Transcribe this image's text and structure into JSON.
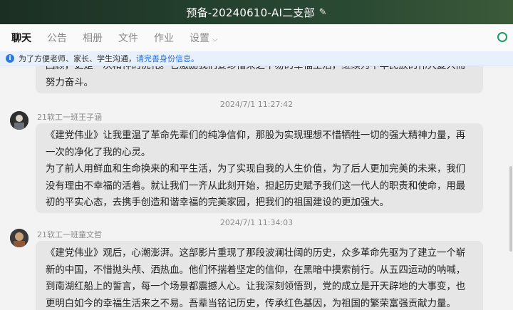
{
  "window": {
    "title": "预备-20240610-AI二支部"
  },
  "tabs": [
    "聊天",
    "公告",
    "相册",
    "文件",
    "作业",
    "设置"
  ],
  "notice": {
    "text": "为了方便老师、家长、学生沟通，",
    "link": "请完善身份信息。"
  },
  "messages": [
    {
      "time": "",
      "sender": "",
      "lines": [
        "回顾，更是一次精神的洗礼。它激励我们要珍惜来之不易的幸福生活，继续为中华民族的伟大复兴而",
        "努力奋斗。"
      ]
    },
    {
      "time": "2024/7/1 11:27:42",
      "sender": "21软工一班王子涵",
      "lines": [
        "《建党伟业》让我重温了革命先辈们的纯净信仰，那股为实现理想不惜牺牲一切的强大精神力量，再",
        "一次的净化了我的心灵。",
        "为了前人用鲜血和生命换来的和平生活，为了实现自我的人生价值，为了后人更加完美的未来，我们",
        "没有理由不幸福的活着。就让我们一齐从此刻开始，担起历史赋予我们这一代人的职责和使命，用最",
        "初的平实心态，去携手创造和谐幸福的完美家园，把我们的祖国建设的更加强大。"
      ]
    },
    {
      "time": "2024/7/1 11:34:03",
      "sender": "21软工一班童文哲",
      "lines": [
        "《建党伟业》观后，心潮澎湃。这部影片重现了那段波澜壮阔的历史，众多革命先驱为了建立一个崭",
        "新的中国，不惜抛头颅、洒热血。他们怀揣着坚定的信仰，在黑暗中摸索前行。从五四运动的呐喊，",
        "到南湖红船上的誓言，每一个场景都震撼人心。让我深刻领悟到，党的成立是开天辟地的大事变，也",
        "更明白如今的幸福生活来之不易。吾辈当铭记历史，传承红色基因，为祖国的繁荣富强贡献力量。"
      ]
    }
  ]
}
